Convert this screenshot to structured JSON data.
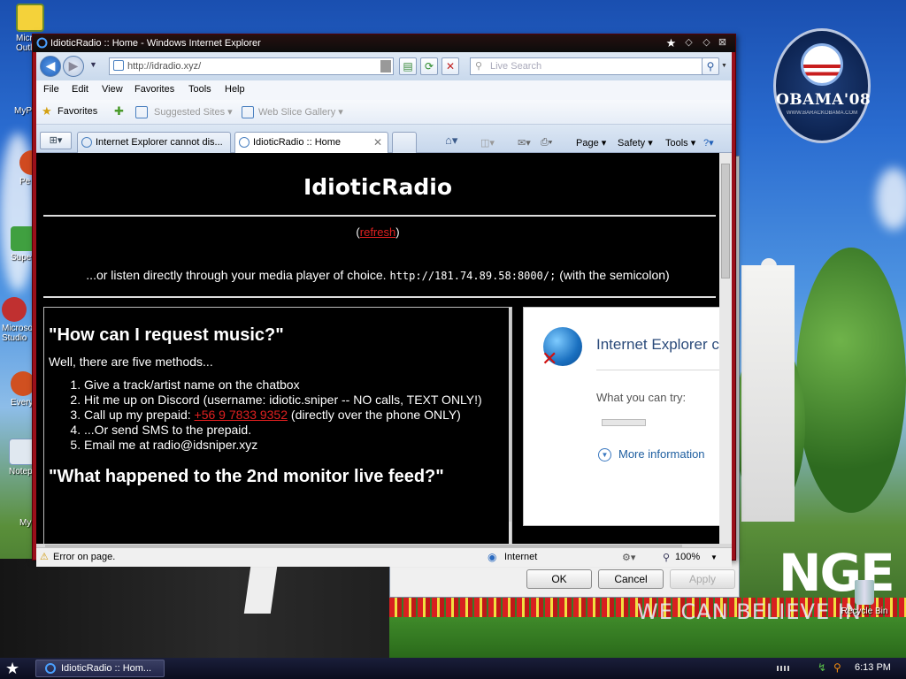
{
  "window": {
    "title": "IdioticRadio :: Home - Windows Internet Explorer"
  },
  "toolbar": {
    "address": "http://idradio.xyz/",
    "search_placeholder": "Live Search"
  },
  "menu": [
    "File",
    "Edit",
    "View",
    "Favorites",
    "Tools",
    "Help"
  ],
  "favorites_bar": {
    "favorites": "Favorites",
    "suggested": "Suggested Sites ▾",
    "webslice": "Web Slice Gallery ▾"
  },
  "tabs": [
    {
      "label": "Internet Explorer cannot dis..."
    },
    {
      "label": "IdioticRadio :: Home"
    }
  ],
  "commands": {
    "page": "Page ▾",
    "safety": "Safety ▾",
    "tools": "Tools ▾"
  },
  "page": {
    "title": "IdioticRadio",
    "refresh_pre": "(",
    "refresh_link": "refresh",
    "refresh_post": ")",
    "listen_pre": "...or listen directly through your media player of choice. ",
    "listen_url": "http://181.74.89.58:8000/;",
    "listen_post": " (with the semicolon)",
    "q1": "\"How can I request music?\"",
    "intro": "Well, there are five methods...",
    "methods": [
      "Give a track/artist name on the chatbox",
      "Hit me up on Discord (username: idiotic.sniper -- NO calls, TEXT ONLY!)",
      "Call up my prepaid: ",
      "...Or send SMS to the prepaid.",
      "Email me at radio@idsniper.xyz"
    ],
    "phone": "+56 9 7833 9352",
    "phone_post": " (directly over the phone ONLY)",
    "q2": "\"What happened to the 2nd monitor live feed?\""
  },
  "error_frame": {
    "title": "Internet Explorer c",
    "try": "What you can try:",
    "more": "More information"
  },
  "status": {
    "text": "Error on page.",
    "zone": "Internet",
    "zoom": "100%"
  },
  "dialog": {
    "ok": "OK",
    "cancel": "Cancel",
    "apply": "Apply"
  },
  "desktop": {
    "badge_title": "OBAMA'08",
    "badge_sub": "WWW.BARACKOBAMA.COM",
    "slogan_big": "NGE",
    "slogan_small": "WE CAN BELIEVE IN",
    "recycle": "Recycle Bin",
    "icons": [
      "Micro Outl",
      "MyP",
      "Pe",
      "Super",
      "Microso Studio",
      "Every",
      "Notep",
      "My"
    ]
  },
  "taskbar": {
    "task": "IdioticRadio :: Hom...",
    "clock": "6:13 PM"
  },
  "colors": {
    "ie_frame": "#9a0f1a",
    "link_red": "#e02020",
    "page_bg": "#000000"
  }
}
